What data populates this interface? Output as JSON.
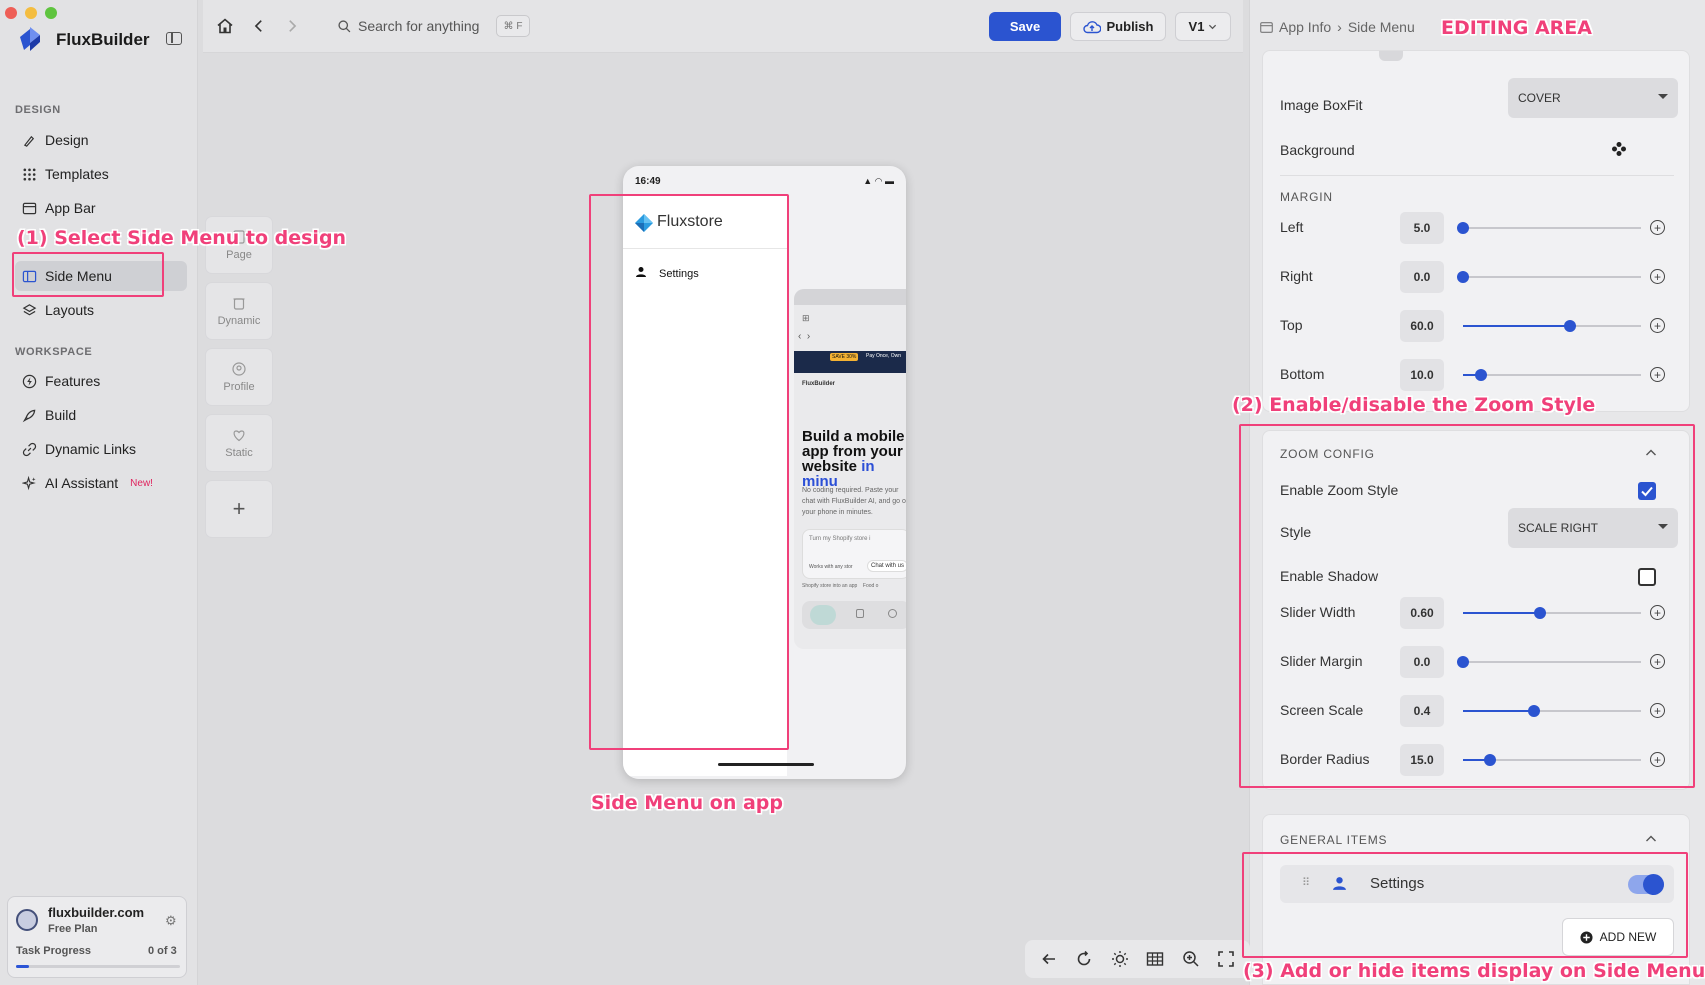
{
  "app": {
    "brand": "FluxBuilder"
  },
  "sidebar": {
    "design_label": "DESIGN",
    "workspace_label": "WORKSPACE",
    "design_items": [
      {
        "label": "Design",
        "icon": "brush-icon"
      },
      {
        "label": "Templates",
        "icon": "grid-icon"
      },
      {
        "label": "App Bar",
        "icon": "window-icon"
      },
      {
        "label": "Side Menu",
        "icon": "sidebar-icon",
        "active": true
      },
      {
        "label": "Layouts",
        "icon": "layers-icon"
      }
    ],
    "workspace_items": [
      {
        "label": "Features",
        "icon": "bolt-icon"
      },
      {
        "label": "Build",
        "icon": "rocket-icon"
      },
      {
        "label": "Dynamic Links",
        "icon": "link-icon"
      },
      {
        "label": "AI Assistant",
        "icon": "sparkle-icon",
        "badge": "New!"
      }
    ],
    "site": {
      "name": "fluxbuilder.com",
      "plan": "Free Plan",
      "task_label": "Task Progress",
      "task_count": "0 of 3",
      "task_progress": 0.08
    }
  },
  "page_tiles": [
    {
      "label": "Page"
    },
    {
      "label": "Dynamic"
    },
    {
      "label": "Profile"
    },
    {
      "label": "Static"
    }
  ],
  "topbar": {
    "search_placeholder": "Search for anything",
    "shortcut": "⌘ F",
    "save": "Save",
    "publish": "Publish",
    "version": "V1"
  },
  "phone": {
    "time": "16:49",
    "app_name": "Fluxstore",
    "menu_items": [
      "Settings"
    ],
    "preview": {
      "headline_1": "Build a mobile app from your website",
      "headline_2": "in minu",
      "copy": "No coding required. Paste your chat with FluxBuilder AI, and go on your phone in minutes.",
      "card_text": "Turn my Shopify store i",
      "card_chip": "Chat with us",
      "works_text": "Works with any stor",
      "chip_1": "Shopify store into an app",
      "chip_2": "Food o",
      "promo_badge": "SAVE 30%",
      "promo_text": "Pay Once, Own",
      "brand": "FluxBuilder"
    }
  },
  "right_panel": {
    "breadcrumb": [
      "App Info",
      "Side Menu"
    ],
    "image_boxfit_label": "Image BoxFit",
    "image_boxfit_value": "COVER",
    "background_label": "Background",
    "margin_title": "MARGIN",
    "margins": [
      {
        "label": "Left",
        "value": "5.0",
        "fraction": 0.0
      },
      {
        "label": "Right",
        "value": "0.0",
        "fraction": 0.0
      },
      {
        "label": "Top",
        "value": "60.0",
        "fraction": 0.6
      },
      {
        "label": "Bottom",
        "value": "10.0",
        "fraction": 0.1
      }
    ],
    "zoom_title": "ZOOM CONFIG",
    "enable_zoom_label": "Enable Zoom Style",
    "enable_zoom_checked": true,
    "style_label": "Style",
    "style_value": "SCALE RIGHT",
    "enable_shadow_label": "Enable Shadow",
    "enable_shadow_checked": false,
    "zoom_sliders": [
      {
        "label": "Slider Width",
        "value": "0.60",
        "fraction": 0.43
      },
      {
        "label": "Slider Margin",
        "value": "0.0",
        "fraction": 0.0
      },
      {
        "label": "Screen Scale",
        "value": "0.4",
        "fraction": 0.4
      },
      {
        "label": "Border Radius",
        "value": "15.0",
        "fraction": 0.15
      }
    ],
    "general_title": "GENERAL ITEMS",
    "general_items": [
      {
        "label": "Settings",
        "enabled": true
      }
    ],
    "add_new": "ADD NEW"
  },
  "annotations": {
    "editing_area": "EDITING AREA",
    "step1": "(1) Select Side Menu to design",
    "step2": "(2) Enable/disable the Zoom Style",
    "step3": "(3) Add or hide items display on Side Menu",
    "side_menu_on_app": "Side Menu on app"
  },
  "colors": {
    "accent": "#2b54d0",
    "annotation": "#f0407a"
  }
}
